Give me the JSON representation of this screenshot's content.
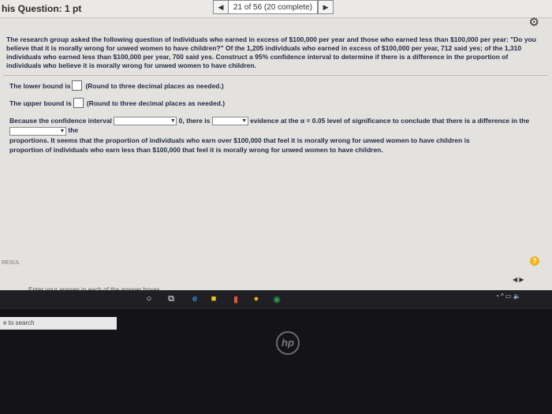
{
  "header": {
    "question_label": "his Question: 1 pt",
    "progress": "21 of 56 (20 complete)",
    "prev_arrow": "◀",
    "next_arrow": "▶",
    "settings_icon": "gear-icon"
  },
  "question": {
    "prompt": "The research group asked the following question of individuals who earned in excess of $100,000 per year and those who earned less than $100,000 per year: \"Do you believe that it is morally wrong for unwed women to have children?\" Of the 1,205 individuals who earned in excess of $100,000 per year, 712 said yes; of the 1,310 individuals who earned less than $100,000 per year, 700 said yes. Construct a 95% confidence interval to determine if there is a difference in the proportion of individuals who believe it is morally wrong for unwed women to have children.",
    "lower_bound_label": "The lower bound is",
    "lower_bound_hint": "(Round to three decimal places as needed.)",
    "upper_bound_label": "The upper bound is",
    "upper_bound_hint": "(Round to three decimal places as needed.)",
    "because_text": "Because the confidence interval",
    "zero_there_is": "0, there is",
    "evidence_text": "evidence at the α = 0.05 level of significance to conclude that there is a difference in the",
    "the_text": "the",
    "proportions_text": "proportions. It seems that the proportion of individuals who earn over $100,000 that feel it is morally wrong for unwed women to have children is",
    "proportion_end": "proportion of individuals who earn less than $100,000 that feel it is morally wrong for unwed women to have children."
  },
  "footer": {
    "results_label": "RESUL",
    "instruction": "Enter your answer in each of the answer boxes.",
    "help_icon": "?"
  },
  "taskbar": {
    "search_text": "e to search",
    "brand": "hp"
  }
}
